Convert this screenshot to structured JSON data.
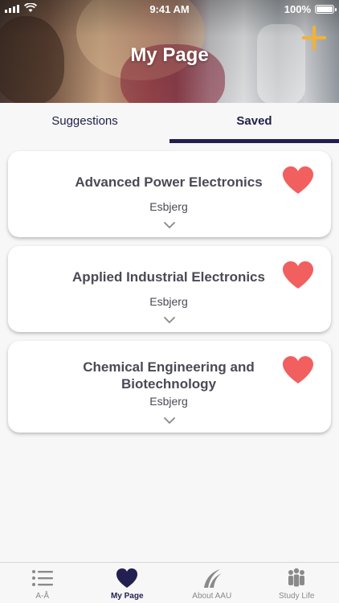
{
  "status_bar": {
    "time": "9:41 AM",
    "battery": "100%"
  },
  "header": {
    "title": "My Page"
  },
  "tabs": [
    {
      "label": "Suggestions",
      "active": false
    },
    {
      "label": "Saved",
      "active": true
    }
  ],
  "saved": [
    {
      "title_lines": [
        "Advanced Power Electronics"
      ],
      "location": "Esbjerg"
    },
    {
      "title_lines": [
        "Applied Industrial Electronics"
      ],
      "location": "Esbjerg"
    },
    {
      "title_lines": [
        "Chemical Engineering and",
        "Biotechnology"
      ],
      "location": "Esbjerg"
    }
  ],
  "bottom_nav": [
    {
      "label": "A-Å",
      "icon": "list-icon",
      "active": false
    },
    {
      "label": "My Page",
      "icon": "heart-icon",
      "active": true
    },
    {
      "label": "About AAU",
      "icon": "aau-logo-icon",
      "active": false
    },
    {
      "label": "Study Life",
      "icon": "people-icon",
      "active": false
    }
  ],
  "colors": {
    "accent": "#231f50",
    "heart": "#f25f5f",
    "add": "#f2b234"
  }
}
